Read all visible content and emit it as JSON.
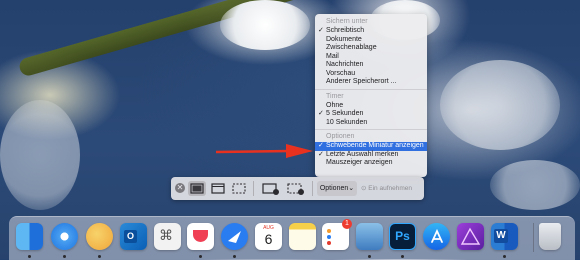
{
  "capture_menu": {
    "save_to": {
      "header": "Sichern unter",
      "items": [
        {
          "label": "Schreibtisch",
          "checked": true
        },
        {
          "label": "Dokumente",
          "checked": false
        },
        {
          "label": "Zwischenablage",
          "checked": false
        },
        {
          "label": "Mail",
          "checked": false
        },
        {
          "label": "Nachrichten",
          "checked": false
        },
        {
          "label": "Vorschau",
          "checked": false
        },
        {
          "label": "Anderer Speicherort ...",
          "checked": false
        }
      ]
    },
    "timer": {
      "header": "Timer",
      "items": [
        {
          "label": "Ohne",
          "checked": false
        },
        {
          "label": "5 Sekunden",
          "checked": true
        },
        {
          "label": "10 Sekunden",
          "checked": false
        }
      ]
    },
    "options": {
      "header": "Optionen",
      "items": [
        {
          "label": "Schwebende Miniatur anzeigen",
          "checked": true,
          "highlighted": true
        },
        {
          "label": "Letzte Auswahl merken",
          "checked": true
        },
        {
          "label": "Mauszeiger anzeigen",
          "checked": false
        }
      ]
    }
  },
  "check_glyph": "✓",
  "toolbar": {
    "close_glyph": "✕",
    "options_label": "Optionen",
    "options_chevron": "⌄",
    "record_label": "Ein aufnehmen",
    "record_glyph": "⊙"
  },
  "dock": {
    "calendar_month": "AUG",
    "calendar_day": "6",
    "photoshop_label": "Ps",
    "word_label": "W",
    "reminders_badge": "1"
  },
  "colors": {
    "arrow": "#e8321f",
    "highlight": "#2f6fe0"
  }
}
